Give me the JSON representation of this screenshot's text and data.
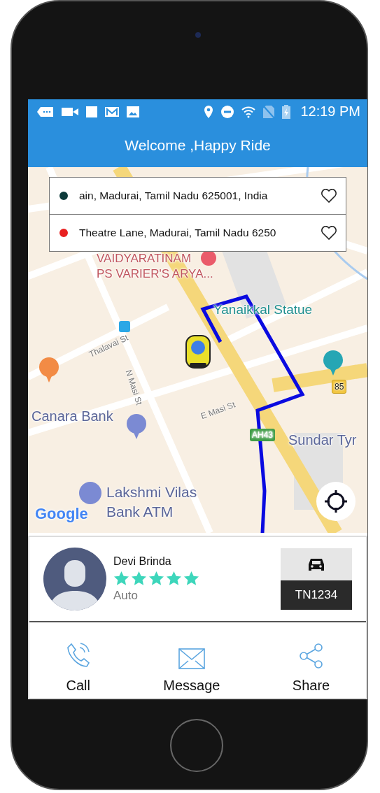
{
  "status_bar": {
    "time": "12:19 PM"
  },
  "header": {
    "title": "Welcome ,Happy Ride"
  },
  "locations": [
    {
      "address": "ain, Madurai, Tamil Nadu 625001, India",
      "color": "#0d3b3b"
    },
    {
      "address": "Theatre Lane, Madurai, Tamil Nadu 6250",
      "color": "#e82020"
    }
  ],
  "map": {
    "labels": [
      {
        "kind": "place",
        "text": "VAIDYARATINAM"
      },
      {
        "kind": "place",
        "text": "PS VARIER'S ARYA..."
      },
      {
        "kind": "landmark",
        "text": "Yanaikkal Statue"
      },
      {
        "kind": "street",
        "text": "Thalavai St"
      },
      {
        "kind": "street",
        "text": "N Masi St"
      },
      {
        "kind": "business",
        "text": "Canara Bank"
      },
      {
        "kind": "street",
        "text": "E Masi St"
      },
      {
        "kind": "highway",
        "text": "AH43"
      },
      {
        "kind": "route",
        "text": "85"
      },
      {
        "kind": "business",
        "text": "Sundar Tyr"
      },
      {
        "kind": "logo",
        "text": "Google"
      },
      {
        "kind": "business",
        "text": "Lakshmi Vilas Bank ATM"
      }
    ]
  },
  "driver": {
    "name": "Devi  Brinda",
    "stars": 5,
    "vehicle_type": "Auto",
    "vehicle_number": "TN1234"
  },
  "actions": [
    {
      "kind": "call",
      "label": "Call"
    },
    {
      "kind": "message",
      "label": "Message"
    },
    {
      "kind": "share",
      "label": "Share"
    }
  ]
}
